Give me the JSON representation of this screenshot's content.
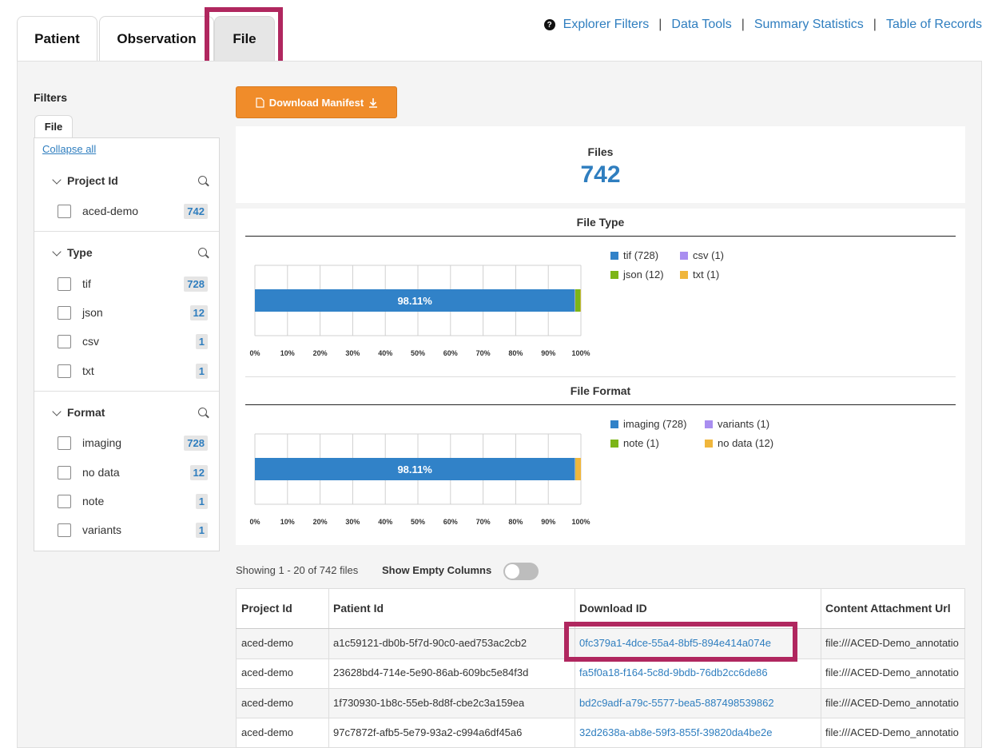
{
  "tabs": [
    {
      "label": "Patient"
    },
    {
      "label": "Observation"
    },
    {
      "label": "File"
    }
  ],
  "top_links": [
    "Explorer Filters",
    "Data Tools",
    "Summary Statistics",
    "Table of Records"
  ],
  "filters": {
    "title": "Filters",
    "tab": "File",
    "collapse_all": "Collapse all",
    "sections": [
      {
        "title": "Project Id",
        "items": [
          {
            "label": "aced-demo",
            "count": "742"
          }
        ]
      },
      {
        "title": "Type",
        "items": [
          {
            "label": "tif",
            "count": "728"
          },
          {
            "label": "json",
            "count": "12"
          },
          {
            "label": "csv",
            "count": "1"
          },
          {
            "label": "txt",
            "count": "1"
          }
        ]
      },
      {
        "title": "Format",
        "items": [
          {
            "label": "imaging",
            "count": "728"
          },
          {
            "label": "no data",
            "count": "12"
          },
          {
            "label": "note",
            "count": "1"
          },
          {
            "label": "variants",
            "count": "1"
          }
        ]
      }
    ]
  },
  "download_button": "Download Manifest",
  "summary": {
    "label": "Files",
    "count": "742"
  },
  "colors": {
    "blue": "#3182c8",
    "purple": "#a98ef0",
    "green": "#7cb518",
    "yellow": "#f0b63c",
    "accent": "#b0275f"
  },
  "chart_data": [
    {
      "type": "bar",
      "title": "File Type",
      "orientation": "horizontal-stacked-percent",
      "categories": [
        "tif",
        "csv",
        "json",
        "txt"
      ],
      "values": [
        728,
        1,
        12,
        1
      ],
      "percent_label": "98.11%",
      "xticks": [
        "0%",
        "10%",
        "20%",
        "30%",
        "40%",
        "50%",
        "60%",
        "70%",
        "80%",
        "90%",
        "100%"
      ],
      "legend": [
        "tif (728)",
        "csv (1)",
        "json (12)",
        "txt (1)"
      ]
    },
    {
      "type": "bar",
      "title": "File Format",
      "orientation": "horizontal-stacked-percent",
      "categories": [
        "imaging",
        "variants",
        "note",
        "no data"
      ],
      "values": [
        728,
        1,
        1,
        12
      ],
      "percent_label": "98.11%",
      "xticks": [
        "0%",
        "10%",
        "20%",
        "30%",
        "40%",
        "50%",
        "60%",
        "70%",
        "80%",
        "90%",
        "100%"
      ],
      "legend": [
        "imaging (728)",
        "variants (1)",
        "note (1)",
        "no data (12)"
      ]
    }
  ],
  "table": {
    "showing": "Showing 1 - 20 of 742 files",
    "show_empty_columns": "Show Empty Columns",
    "headers": [
      "Project Id",
      "Patient Id",
      "Download ID",
      "Content Attachment Url"
    ],
    "rows": [
      [
        "aced-demo",
        "a1c59121-db0b-5f7d-90c0-aed753ac2cb2",
        "0fc379a1-4dce-55a4-8bf5-894e414a074e",
        "file:///ACED-Demo_annotatio"
      ],
      [
        "aced-demo",
        "23628bd4-714e-5e90-86ab-609bc5e84f3d",
        "fa5f0a18-f164-5c8d-9bdb-76db2cc6de86",
        "file:///ACED-Demo_annotatio"
      ],
      [
        "aced-demo",
        "1f730930-1b8c-55eb-8d8f-cbe2c3a159ea",
        "bd2c9adf-a79c-5577-bea5-887498539862",
        "file:///ACED-Demo_annotatio"
      ],
      [
        "aced-demo",
        "97c7872f-afb5-5e79-93a2-c994a6df45a6",
        "32d2638a-ab8e-59f3-855f-39820da4be2e",
        "file:///ACED-Demo_annotatio"
      ]
    ]
  }
}
